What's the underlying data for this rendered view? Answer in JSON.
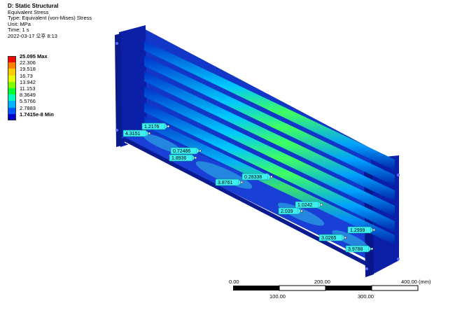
{
  "header": {
    "title": "D: Static Structural",
    "lines": [
      "Equivalent Stress",
      "Type: Equivalent (von-Mises) Stress",
      "Unit: MPa",
      "Time: 1 s",
      "2022-03-17 오후 8:13"
    ]
  },
  "legend": {
    "levels": [
      {
        "label": "25.095 Max",
        "color": "#ff0000",
        "bold": true
      },
      {
        "label": "22.306",
        "color": "#ff8000",
        "bold": false
      },
      {
        "label": "19.518",
        "color": "#ffcc00",
        "bold": false
      },
      {
        "label": "16.73",
        "color": "#e6ff00",
        "bold": false
      },
      {
        "label": "13.942",
        "color": "#80ff00",
        "bold": false
      },
      {
        "label": "11.153",
        "color": "#00ff33",
        "bold": false
      },
      {
        "label": "8.3649",
        "color": "#00ffbf",
        "bold": false
      },
      {
        "label": "5.5766",
        "color": "#00b3ff",
        "bold": false
      },
      {
        "label": "2.7883",
        "color": "#0055ff",
        "bold": false
      },
      {
        "label": "1.7415e-8 Min",
        "color": "#0000cc",
        "bold": true
      }
    ]
  },
  "probes": [
    {
      "value": "1.2176"
    },
    {
      "value": "4.3151"
    },
    {
      "value": "0.72486"
    },
    {
      "value": "1.8936"
    },
    {
      "value": "0.28338"
    },
    {
      "value": "3.8761"
    },
    {
      "value": "1.0242"
    },
    {
      "value": "2.039"
    },
    {
      "value": "1.2999"
    },
    {
      "value": "3.0265"
    },
    {
      "value": "3.9788"
    }
  ],
  "scale": {
    "top_labels": [
      "0.00",
      "200.00",
      "400.00 (mm)"
    ],
    "bottom_labels": [
      "100.00",
      "300.00"
    ]
  }
}
